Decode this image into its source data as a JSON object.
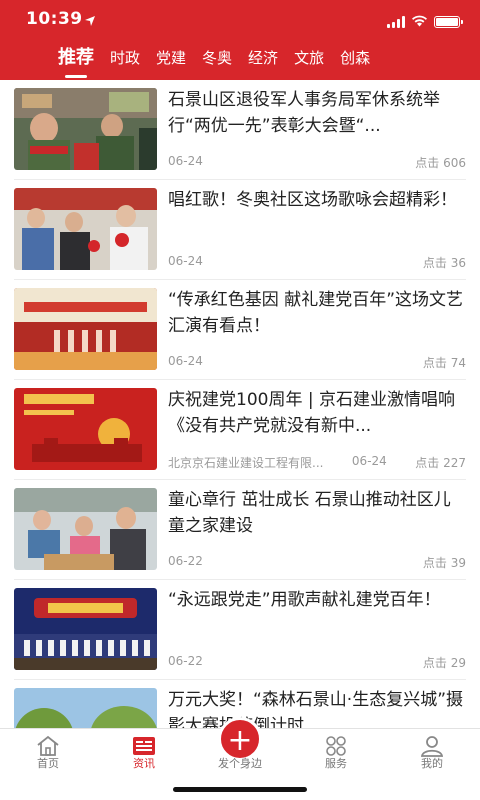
{
  "status_bar": {
    "time": "10:39"
  },
  "tabs": [
    "推荐",
    "时政",
    "党建",
    "冬奥",
    "经济",
    "文旅",
    "创森"
  ],
  "active_tab": "推荐",
  "colors": {
    "brand_red": "#d7262b"
  },
  "feed": [
    {
      "title": "石景山区退役军人事务局军休系统举行“两优一先”表彰大会暨“...",
      "source": "",
      "date": "06-24",
      "views": "点击 606"
    },
    {
      "title": "唱红歌！冬奥社区这场歌咏会超精彩！",
      "source": "",
      "date": "06-24",
      "views": "点击 36"
    },
    {
      "title": "“传承红色基因 献礼建党百年”这场文艺汇演有看点！",
      "source": "",
      "date": "06-24",
      "views": "点击 74"
    },
    {
      "title": "庆祝建党100周年 | 京石建业激情唱响《没有共产党就没有新中...",
      "source": "北京京石建业建设工程有限...",
      "date": "06-24",
      "views": "点击 227"
    },
    {
      "title": "童心章行 茁壮成长 石景山推动社区儿童之家建设",
      "source": "",
      "date": "06-22",
      "views": "点击 39"
    },
    {
      "title": "“永远跟党走”用歌声献礼建党百年！",
      "source": "",
      "date": "06-22",
      "views": "点击 29"
    },
    {
      "title": "万元大奖！“森林石景山·生态复兴城”摄影大赛投稿倒计时",
      "source": "",
      "date": "",
      "views": ""
    }
  ],
  "tabbar": {
    "home": "首页",
    "news": "资讯",
    "post": "发个身边",
    "service": "服务",
    "mine": "我的"
  }
}
